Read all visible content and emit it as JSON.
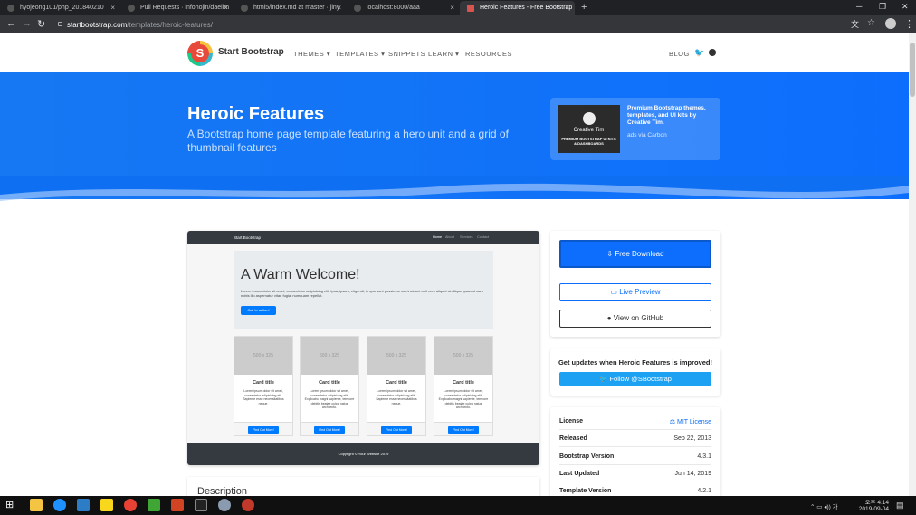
{
  "browser": {
    "tabs": [
      {
        "title": "hyojeong101/php_201840210"
      },
      {
        "title": "Pull Requests · infohojin/daelim"
      },
      {
        "title": "html5/index.md at master · jiny"
      },
      {
        "title": "localhost:8000/aaa"
      },
      {
        "title": "Heroic Features - Free Bootstrap"
      }
    ],
    "url_host": "startbootstrap.com",
    "url_path": "/templates/heroic-features/"
  },
  "site": {
    "brand": "Start Bootstrap",
    "logo_letter": "S",
    "nav": [
      "THEMES ▾",
      "TEMPLATES ▾",
      "SNIPPETS",
      "LEARN ▾",
      "RESOURCES"
    ],
    "blog": "BLOG"
  },
  "hero": {
    "title": "Heroic Features",
    "lead": "A Bootstrap home page template featuring a hero unit and a grid of thumbnail features"
  },
  "ad": {
    "image_text": "Creative Tim",
    "image_subtext": "PREMIUM BOOTSTRAP UI KITS & DASHBOARDS",
    "text": "Premium Bootstrap themes, templates, and UI kits by Creative Tim.",
    "via": "ads via Carbon"
  },
  "preview": {
    "brand": "Start Bootstrap",
    "links": [
      "Home",
      "About",
      "Services",
      "Contact"
    ],
    "jumbo_title": "A Warm Welcome!",
    "jumbo_text": "Lorem ipsum dolor sit amet, consectetur adipisicing elit. Ipsa, ipsam, eligendi, in quo sunt possimus non incidunt odit vero aliquid similique quaerat nam nobis illo aspernatur vitae fugiat numquam repellat.",
    "jumbo_button": "Call to action!",
    "cards": [
      {
        "img": "500 x 325",
        "title": "Card title",
        "text": "Lorem ipsum dolor sit amet, consectetur adipisicing elit. Sapiente esse necessitatibus neque.",
        "button": "Find Out More!"
      },
      {
        "img": "500 x 325",
        "title": "Card title",
        "text": "Lorem ipsum dolor sit amet, consectetur adipisicing elit. Explicabo magni sapiente, tempore debitis beatae culpa natus architecto.",
        "button": "Find Out More!"
      },
      {
        "img": "500 x 325",
        "title": "Card title",
        "text": "Lorem ipsum dolor sit amet, consectetur adipisicing elit. Sapiente esse necessitatibus neque.",
        "button": "Find Out More!"
      },
      {
        "img": "500 x 325",
        "title": "Card title",
        "text": "Lorem ipsum dolor sit amet, consectetur adipisicing elit. Explicabo magni sapiente, tempore debitis beatae culpa natus architecto.",
        "button": "Find Out More!"
      }
    ],
    "footer": "Copyright © Your Website 2019"
  },
  "description_heading": "Description",
  "actions": {
    "download": "⇩ Free Download",
    "live_preview": "▭ Live Preview",
    "github": "● View on GitHub"
  },
  "updates": {
    "text": "Get updates when Heroic Features is improved!",
    "follow": "Follow @SBootstrap"
  },
  "info": [
    {
      "key": "License",
      "value": "MIT License",
      "link": true
    },
    {
      "key": "Released",
      "value": "Sep 22, 2013",
      "link": false
    },
    {
      "key": "Bootstrap Version",
      "value": "4.3.1",
      "link": false
    },
    {
      "key": "Last Updated",
      "value": "Jun 14, 2019",
      "link": false
    },
    {
      "key": "Template Version",
      "value": "4.2.1",
      "link": false
    }
  ],
  "taskbar": {
    "time": "오후 4:14",
    "date": "2019-09-04"
  },
  "colors": {
    "primary": "#0d6efd",
    "twitter": "#1da1f2",
    "dark": "#343a40"
  }
}
